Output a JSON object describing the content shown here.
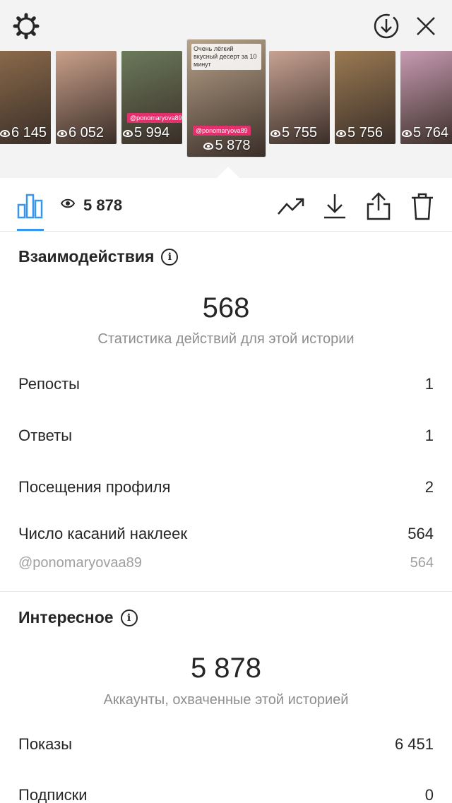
{
  "stories": [
    {
      "views": "6 145",
      "color": "#8a6a4a",
      "tag": "",
      "tag2": ""
    },
    {
      "views": "6 052",
      "color": "#c9a08a",
      "tag": "",
      "tag2": ""
    },
    {
      "views": "5 994",
      "color": "#6b7a5b",
      "tag": "",
      "tag2": "@ponomaryova89"
    },
    {
      "views": "5 878",
      "color": "#b9a48a",
      "tag": "Очень лёгкий вкусный десерт за 10 минут",
      "tag2": "@ponomaryova89"
    },
    {
      "views": "5 755",
      "color": "#c7a292",
      "tag": "",
      "tag2": ""
    },
    {
      "views": "5 756",
      "color": "#9a7a52",
      "tag": "",
      "tag2": ""
    },
    {
      "views": "5 764",
      "color": "#c79bb2",
      "tag": "",
      "tag2": ""
    }
  ],
  "toolbar": {
    "views": "5 878"
  },
  "interactions": {
    "title": "Взаимодействия",
    "total": "568",
    "caption": "Статистика действий для этой истории",
    "rows": [
      {
        "label": "Репосты",
        "value": "1"
      },
      {
        "label": "Ответы",
        "value": "1"
      },
      {
        "label": "Посещения профиля",
        "value": "2"
      },
      {
        "label": "Число касаний наклеек",
        "value": "564"
      }
    ],
    "sticker": {
      "label": "@ponomaryovaa89",
      "value": "564"
    }
  },
  "discovery": {
    "title": "Интересное",
    "total": "5 878",
    "caption": "Аккаунты, охваченные этой историей",
    "rows": [
      {
        "label": "Показы",
        "value": "6 451"
      },
      {
        "label": "Подписки",
        "value": "0"
      }
    ]
  },
  "colors": {
    "accent": "#3797f0",
    "background_top": "#f3f3f3",
    "text": "#262626",
    "muted": "#8e8e8e"
  }
}
